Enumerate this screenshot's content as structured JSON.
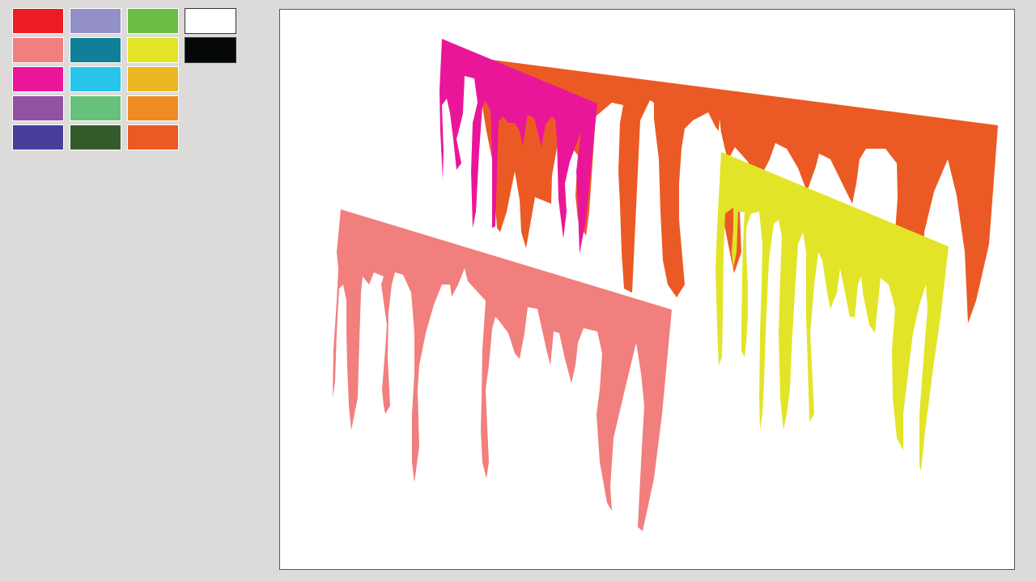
{
  "palette": {
    "swatches": [
      {
        "name": "red",
        "color": "#ed1c24"
      },
      {
        "name": "lavender",
        "color": "#9390c9"
      },
      {
        "name": "green",
        "color": "#6cbe45"
      },
      {
        "name": "white",
        "color": "#ffffff"
      },
      {
        "name": "salmon",
        "color": "#f17f7d"
      },
      {
        "name": "teal",
        "color": "#0f7f9a"
      },
      {
        "name": "yellow",
        "color": "#e2e428"
      },
      {
        "name": "black",
        "color": "#050808"
      },
      {
        "name": "magenta",
        "color": "#ea1699"
      },
      {
        "name": "sky-blue",
        "color": "#27c4ec"
      },
      {
        "name": "gold",
        "color": "#ebb722"
      },
      {
        "name": "purple",
        "color": "#9052a1"
      },
      {
        "name": "mint-green",
        "color": "#66c27b"
      },
      {
        "name": "orange",
        "color": "#ef8b25"
      },
      {
        "name": "indigo",
        "color": "#473e9c"
      },
      {
        "name": "dark-green",
        "color": "#345a2b"
      },
      {
        "name": "red-orange",
        "color": "#eb5a24"
      }
    ]
  },
  "canvas": {
    "background": "#ffffff",
    "drip_shapes": [
      {
        "name": "orange-drip-shape",
        "color": "#eb5a24"
      },
      {
        "name": "magenta-drip-shape",
        "color": "#ea1699"
      },
      {
        "name": "salmon-drip-shape",
        "color": "#f17f7d"
      },
      {
        "name": "yellow-drip-shape",
        "color": "#e2e428"
      }
    ]
  }
}
